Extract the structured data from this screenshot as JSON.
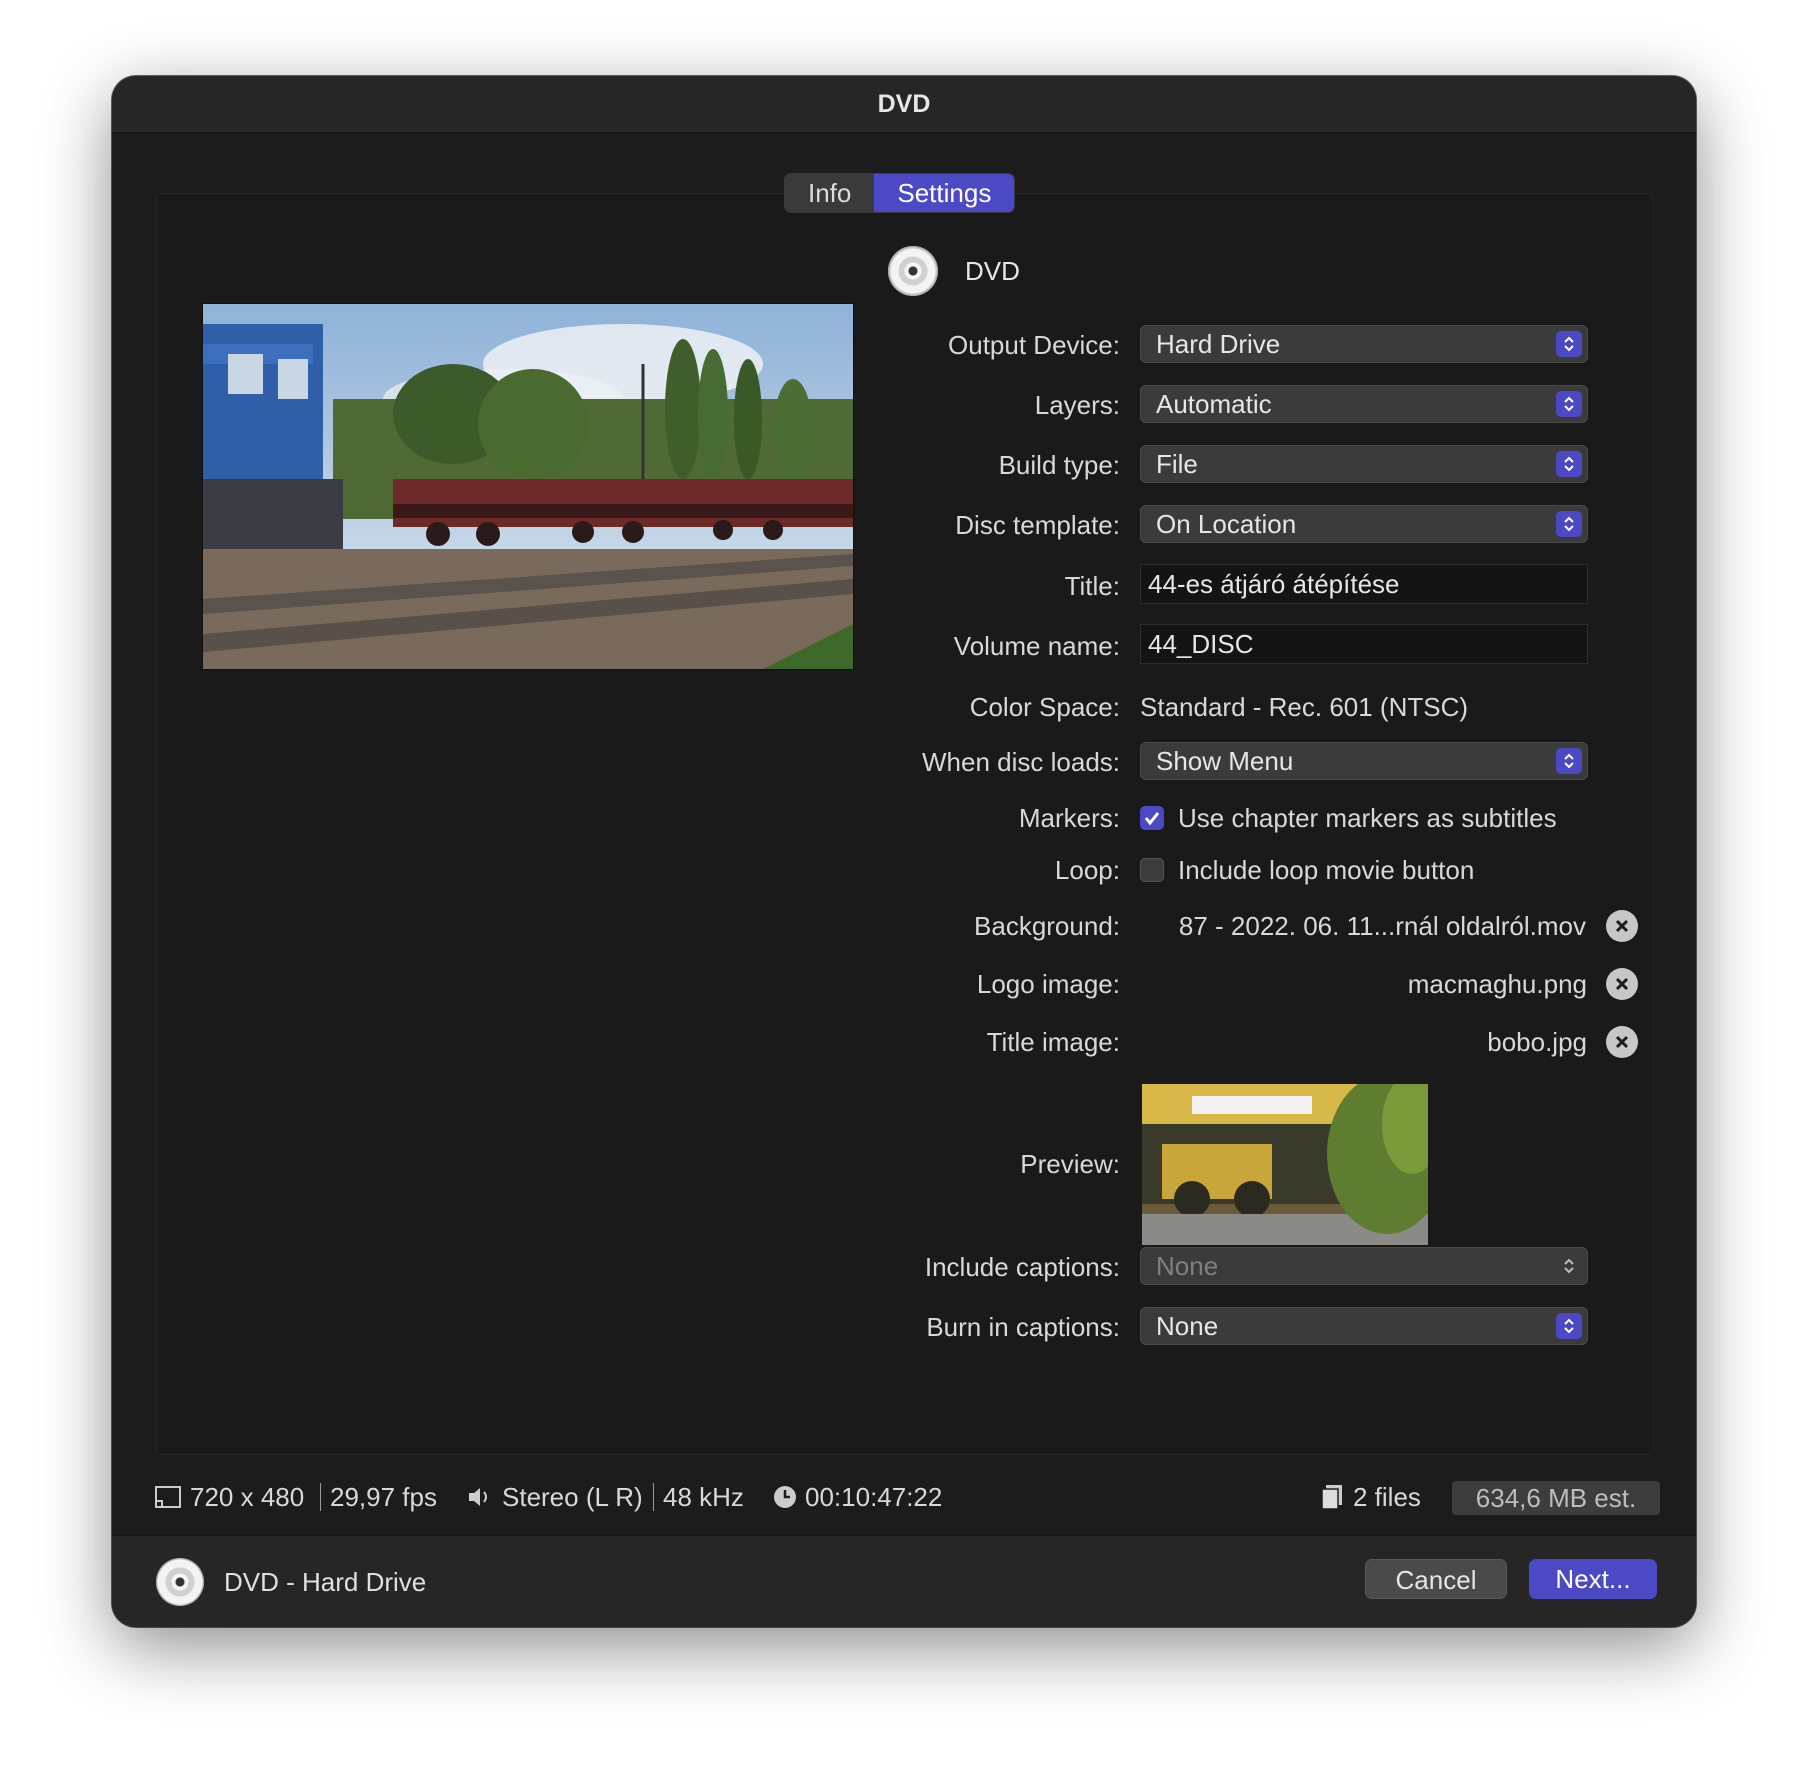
{
  "window": {
    "title": "DVD"
  },
  "tabs": [
    {
      "label": "Info",
      "active": false
    },
    {
      "label": "Settings",
      "active": true
    }
  ],
  "header": {
    "label": "DVD",
    "icon": "disc-icon"
  },
  "settings": {
    "output_device": {
      "label": "Output Device:",
      "value": "Hard Drive"
    },
    "layers": {
      "label": "Layers:",
      "value": "Automatic"
    },
    "build_type": {
      "label": "Build type:",
      "value": "File"
    },
    "disc_template": {
      "label": "Disc template:",
      "value": "On Location"
    },
    "title": {
      "label": "Title:",
      "value": "44-es átjáró átépítése"
    },
    "volume_name": {
      "label": "Volume name:",
      "value": "44_DISC"
    },
    "color_space": {
      "label": "Color Space:",
      "value": "Standard - Rec. 601 (NTSC)"
    },
    "when_disc_loads": {
      "label": "When disc loads:",
      "value": "Show Menu"
    },
    "markers": {
      "label": "Markers:",
      "checkbox_label": "Use chapter markers as subtitles",
      "checked": true
    },
    "loop": {
      "label": "Loop:",
      "checkbox_label": "Include loop movie button",
      "checked": false
    },
    "background": {
      "label": "Background:",
      "value": "87 - 2022. 06. 11...rnál oldalról.mov"
    },
    "logo_image": {
      "label": "Logo image:",
      "value": "macmaghu.png"
    },
    "title_image": {
      "label": "Title image:",
      "value": "bobo.jpg"
    },
    "preview": {
      "label": "Preview:"
    },
    "include_captions": {
      "label": "Include captions:",
      "value": "None",
      "enabled": false
    },
    "burn_in_captions": {
      "label": "Burn in captions:",
      "value": "None"
    }
  },
  "status": {
    "resolution": "720 x 480",
    "fps": "29,97 fps",
    "audio": "Stereo (L R)",
    "sample_rate": "48 kHz",
    "duration": "00:10:47:22",
    "files": "2 files",
    "size": "634,6 MB est."
  },
  "footer": {
    "label": "DVD - Hard Drive",
    "cancel_label": "Cancel",
    "next_label": "Next..."
  },
  "colors": {
    "accent": "#4b49c4",
    "window_bg": "#1c1c1c",
    "text": "#d8d8d8"
  }
}
